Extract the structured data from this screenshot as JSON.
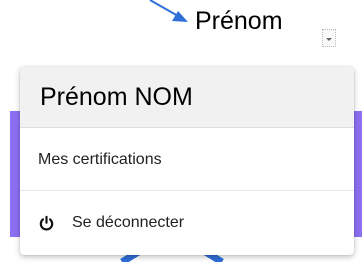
{
  "annotation": {
    "label": "Prénom"
  },
  "user_menu": {
    "header_name": "Prénom NOM",
    "items": [
      {
        "label": "Mes certifications",
        "icon": null
      },
      {
        "label": "Se déconnecter",
        "icon": "power-icon"
      }
    ]
  },
  "colors": {
    "accent_band": "#8c6ff2",
    "annotation_arrow": "#2f6fd8"
  }
}
